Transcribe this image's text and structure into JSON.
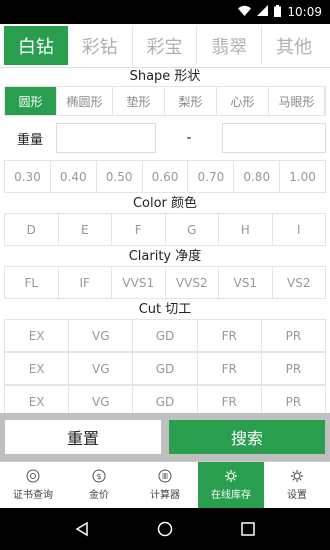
{
  "status_bar": {
    "time": "10:09"
  },
  "tabs": [
    {
      "label": "白钻",
      "active": true
    },
    {
      "label": "彩钻",
      "active": false
    },
    {
      "label": "彩宝",
      "active": false
    },
    {
      "label": "翡翠",
      "active": false
    },
    {
      "label": "其他",
      "active": false
    }
  ],
  "shape": {
    "title": "Shape 形状",
    "options": [
      "圆形",
      "椭圆形",
      "垫形",
      "梨形",
      "心形",
      "马眼形"
    ]
  },
  "weight": {
    "label": "重量",
    "separator": "-",
    "values": [
      "0.30",
      "0.40",
      "0.50",
      "0.60",
      "0.70",
      "0.80",
      "1.00"
    ]
  },
  "color": {
    "title": "Color 颜色",
    "values": [
      "D",
      "E",
      "F",
      "G",
      "H",
      "I"
    ]
  },
  "clarity": {
    "title": "Clarity 净度",
    "values": [
      "FL",
      "IF",
      "VVS1",
      "VVS2",
      "VS1",
      "VS2"
    ]
  },
  "cut": {
    "title": "Cut 切工",
    "rows": [
      [
        "EX",
        "VG",
        "GD",
        "FR",
        "PR"
      ],
      [
        "EX",
        "VG",
        "GD",
        "FR",
        "PR"
      ],
      [
        "EX",
        "VG",
        "GD",
        "FR",
        "PR"
      ]
    ]
  },
  "actions": {
    "reset": "重置",
    "search": "搜索"
  },
  "bottom_nav": [
    {
      "label": "证书查询",
      "icon": "certificate-icon",
      "active": false
    },
    {
      "label": "金价",
      "icon": "dollar-icon",
      "active": false
    },
    {
      "label": "计算器",
      "icon": "calculator-icon",
      "active": false
    },
    {
      "label": "在线库存",
      "icon": "inventory-gear-icon",
      "active": true
    },
    {
      "label": "设置",
      "icon": "gear-icon",
      "active": false
    }
  ],
  "colors": {
    "accent": "#2a9e4f"
  }
}
